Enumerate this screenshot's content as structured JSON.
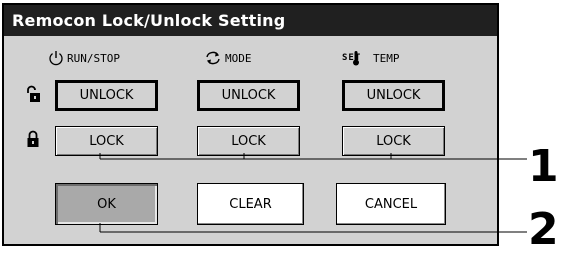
{
  "dialog": {
    "title": "Remocon Lock/Unlock Setting",
    "columns": [
      {
        "id": "run-stop",
        "label": "RUN/STOP",
        "icon": "power-icon"
      },
      {
        "id": "mode",
        "label": "MODE",
        "icon": "mode-cycle-icon"
      },
      {
        "id": "set-temp",
        "label": "TEMP",
        "icon": "set-temp-icon",
        "icon_text": "SET"
      }
    ],
    "rows": {
      "unlock": {
        "icon": "unlocked-padlock-icon",
        "labels": [
          "UNLOCK",
          "UNLOCK",
          "UNLOCK"
        ]
      },
      "lock": {
        "icon": "locked-padlock-icon",
        "labels": [
          "LOCK",
          "LOCK",
          "LOCK"
        ]
      }
    },
    "buttons": {
      "ok": "OK",
      "clear": "CLEAR",
      "cancel": "CANCEL"
    }
  },
  "callouts": {
    "one": "1",
    "two": "2"
  }
}
